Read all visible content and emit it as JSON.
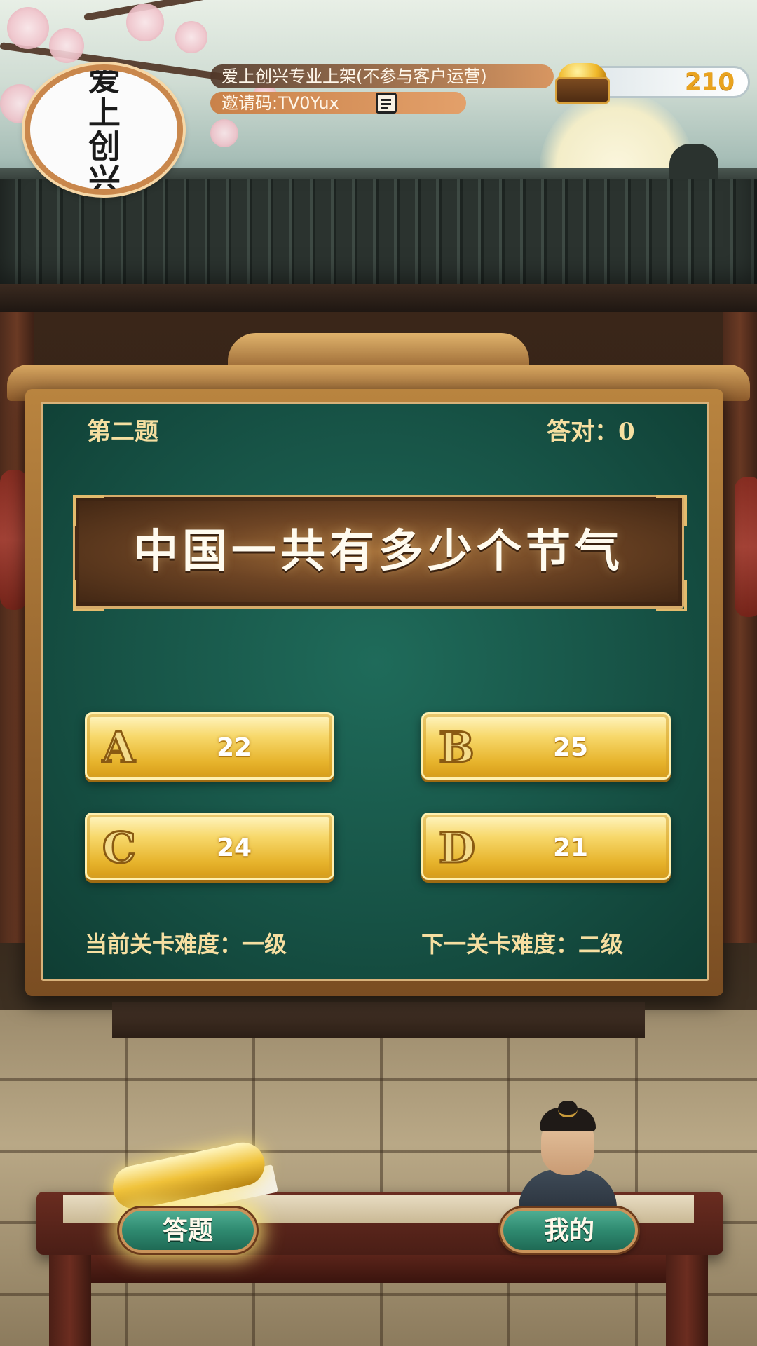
{
  "player": {
    "name": "爱上创兴专业上架(不参与客户运营)",
    "invite_label": "邀请码:TV0Yux",
    "avatar_text": [
      "爱",
      "上",
      "创",
      "兴"
    ],
    "coins": "210"
  },
  "quiz": {
    "question_number": "第二题",
    "score_label": "答对：0",
    "question": "中国一共有多少个节气",
    "options": [
      {
        "letter": "A",
        "value": "22"
      },
      {
        "letter": "B",
        "value": "25"
      },
      {
        "letter": "C",
        "value": "24"
      },
      {
        "letter": "D",
        "value": "21"
      }
    ],
    "current_difficulty": "当前关卡难度：一级",
    "next_difficulty": "下一关卡难度：二级"
  },
  "nav": {
    "answer_label": "答题",
    "mine_label": "我的"
  },
  "colors": {
    "board_green": "#175346",
    "option_gold": "#f7d86b",
    "label_gold": "#f6dfa1",
    "coin_text": "#e9a31f"
  }
}
